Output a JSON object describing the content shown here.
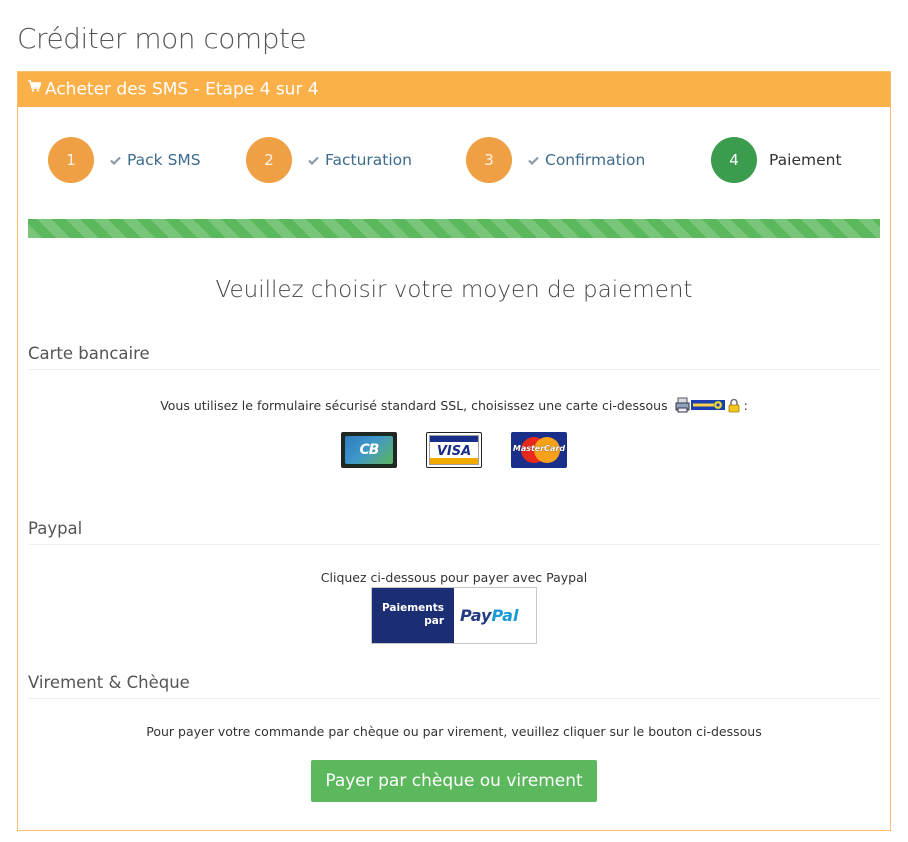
{
  "page": {
    "title": "Créditer mon compte"
  },
  "panel": {
    "heading": "Acheter des SMS - Etape 4 sur 4",
    "heading_icon": "shopping-cart-icon"
  },
  "steps": [
    {
      "number": "1",
      "label": "Pack SMS",
      "done": true
    },
    {
      "number": "2",
      "label": "Facturation",
      "done": true
    },
    {
      "number": "3",
      "label": "Confirmation",
      "done": true
    },
    {
      "number": "4",
      "label": "Paiement",
      "done": false,
      "active": true
    }
  ],
  "progress": {
    "value": 1.0,
    "color": "#5cb85c"
  },
  "choose_title": "Veuillez choisir votre moyen de paiement",
  "card_section": {
    "title": "Carte bancaire",
    "description": "Vous utilisez le formulaire sécurisé standard SSL, choisissez une carte ci-dessous",
    "suffix": ":",
    "security_icons": [
      "printer-lock-icon",
      "key-icon",
      "padlock-icon"
    ],
    "cards": [
      {
        "name": "CB",
        "label": "CB"
      },
      {
        "name": "Visa",
        "label": "VISA"
      },
      {
        "name": "MasterCard",
        "label": "MasterCard"
      }
    ]
  },
  "paypal_section": {
    "title": "Paypal",
    "description": "Cliquez ci-dessous pour payer avec Paypal",
    "button_left_line1": "Paiements",
    "button_left_line2": "par",
    "button_brand_pay": "Pay",
    "button_brand_pal": "Pal"
  },
  "cheque_section": {
    "title": "Virement & Chèque",
    "description": "Pour payer votre commande par chèque ou par virement, veuillez cliquer sur le bouton ci-dessous",
    "button_label": "Payer par chèque ou virement"
  },
  "colors": {
    "accent_orange": "#fbb04a",
    "step_orange": "#f0a044",
    "step_active_green": "#3a9c4c",
    "button_green": "#5cb85c",
    "link_blue": "#3d6b8c"
  }
}
